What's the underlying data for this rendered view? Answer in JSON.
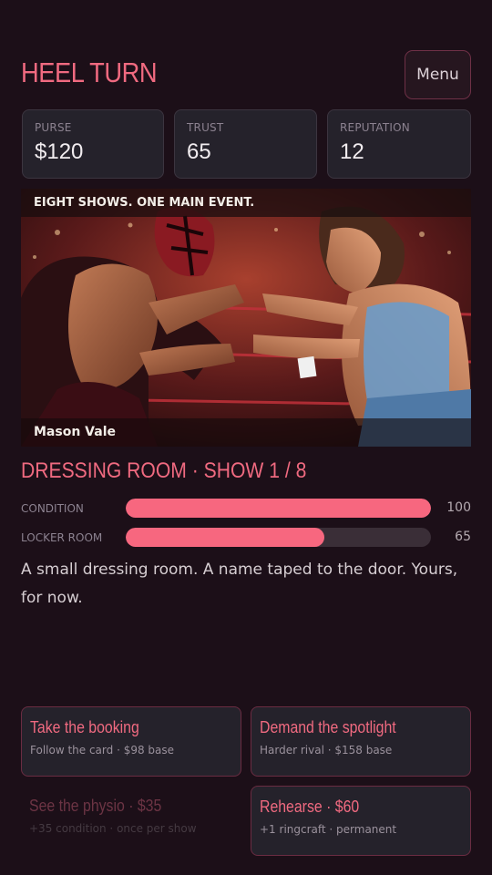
{
  "header": {
    "title": "HEEL TURN",
    "menu_label": "Menu"
  },
  "stats": [
    {
      "label": "PURSE",
      "value": "$120"
    },
    {
      "label": "TRUST",
      "value": "65"
    },
    {
      "label": "REPUTATION",
      "value": "12"
    }
  ],
  "hero": {
    "banner": "EIGHT SHOWS. ONE MAIN EVENT.",
    "caption": "Mason Vale"
  },
  "location": "DRESSING ROOM · SHOW 1 / 8",
  "meters": [
    {
      "label": "CONDITION",
      "value": "100",
      "fraction": 1.0
    },
    {
      "label": "LOCKER ROOM",
      "value": "65",
      "fraction": 0.65
    }
  ],
  "story": "A small dressing room. A name taped to the door. Yours, for now.",
  "actions": [
    {
      "title": "Take the booking",
      "sub": "Follow the card · $98 base",
      "enabled": true
    },
    {
      "title": "Demand the spotlight",
      "sub": "Harder rival · $158 base",
      "enabled": true
    },
    {
      "title": "See the physio · $35",
      "sub": "+35 condition · once per show",
      "enabled": false
    },
    {
      "title": "Rehearse · $60",
      "sub": "+1 ringcraft · permanent",
      "enabled": true
    }
  ],
  "colors": {
    "accent": "#f06a80",
    "background": "#1c0f18",
    "card": "#25222b",
    "meter_fill": "#f7677f"
  }
}
